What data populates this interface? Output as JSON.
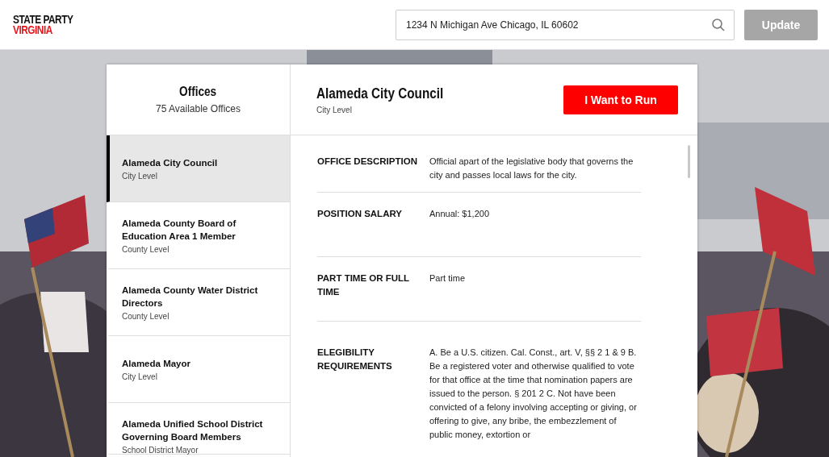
{
  "header": {
    "logo_line_1": "STATE PARTY",
    "logo_line_2": "VIRGINIA",
    "search": {
      "value": "1234 N Michigan Ave Chicago, IL 60602"
    },
    "update_button": {
      "label": "Update",
      "disabled": true
    }
  },
  "offices_panel": {
    "title": "Offices",
    "count": "75 Available Offices",
    "items": [
      {
        "name": "Alameda City Council",
        "level": "City Level",
        "selected": true
      },
      {
        "name": "Alameda County Board of Education Area 1 Member",
        "level": "County Level",
        "selected": false
      },
      {
        "name": "Alameda County Water District Directors",
        "level": "County Level",
        "selected": false
      },
      {
        "name": "Alameda Mayor",
        "level": "City Level",
        "selected": false
      },
      {
        "name": "Alameda Unified School District Governing Board Members",
        "level": "School District Mayor",
        "selected": false
      }
    ]
  },
  "detail": {
    "title": "Alameda City Council",
    "level": "City Level",
    "run_button": "I Want to Run",
    "fields": [
      {
        "label": "OFFICE DESCRIPTION",
        "value": "Official apart of the legislative body that governs the city and passes local laws for the city."
      },
      {
        "label": "POSITION SALARY",
        "value": "Annual: $1,200"
      },
      {
        "label": "PART TIME OR FULL TIME",
        "value": "Part time"
      },
      {
        "label": "ELEGIBILITY REQUIREMENTS",
        "value": "A. Be a U.S. citizen. Cal. Const., art. V, §§ 2 1 & 9 B. Be a registered voter and otherwise qualified to vote for that office at the time that nomination papers are issued to the person. § 201 2 C. Not have been convicted of a felony involving accepting or giving, or offering to give, any bribe, the embezzlement of public money, extortion or"
      }
    ]
  }
}
